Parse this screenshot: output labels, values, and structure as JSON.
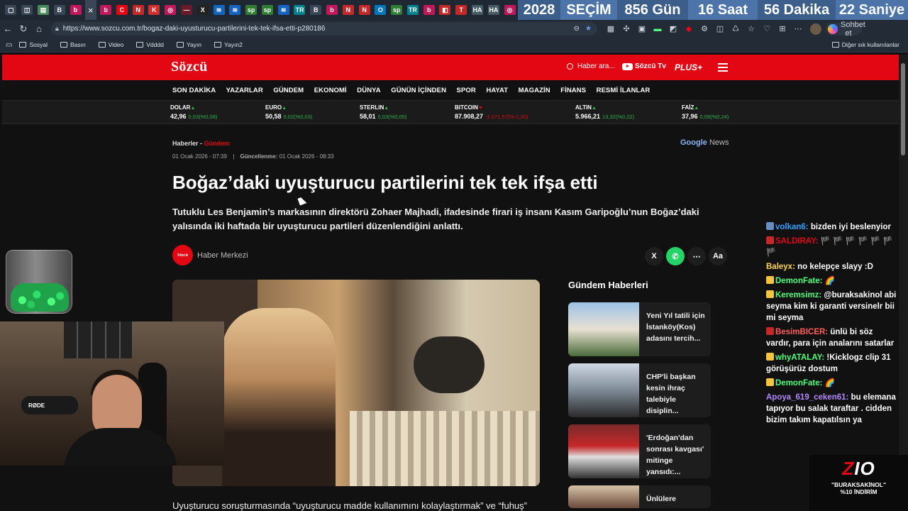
{
  "countdown": {
    "year": "2028",
    "label": "SEÇİM",
    "days": "856 Gün",
    "hours": "16 Saat",
    "minutes": "56 Dakika",
    "seconds": "22 Saniye"
  },
  "tabs": [
    {
      "glyph": "▢",
      "color": "#3a4656"
    },
    {
      "glyph": "◫",
      "color": "#3a4656"
    },
    {
      "glyph": "▤",
      "color": "#4a8a5a"
    },
    {
      "glyph": "B",
      "color": "#3a4656"
    },
    {
      "glyph": "b",
      "color": "#c2185b"
    },
    {
      "glyph": "b",
      "color": "#c2185b"
    },
    {
      "glyph": "C",
      "color": "#e30613"
    },
    {
      "glyph": "N",
      "color": "#c62828"
    },
    {
      "glyph": "K",
      "color": "#d32f2f"
    },
    {
      "glyph": "◎",
      "color": "#c2185b"
    },
    {
      "glyph": "—",
      "color": "#6a1b2a"
    },
    {
      "glyph": "X",
      "color": "#222222"
    },
    {
      "glyph": "≋",
      "color": "#1565c0"
    },
    {
      "glyph": "≋",
      "color": "#1565c0"
    },
    {
      "glyph": "sp",
      "color": "#2e7d32"
    },
    {
      "glyph": "sp",
      "color": "#2e7d32"
    },
    {
      "glyph": "≋",
      "color": "#1565c0"
    },
    {
      "glyph": "TR",
      "color": "#00838f"
    },
    {
      "glyph": "B",
      "color": "#3a4656"
    },
    {
      "glyph": "b",
      "color": "#c2185b"
    },
    {
      "glyph": "N",
      "color": "#c62828"
    },
    {
      "glyph": "N",
      "color": "#c62828"
    },
    {
      "glyph": "O",
      "color": "#0277bd"
    },
    {
      "glyph": "sp",
      "color": "#2e7d32"
    },
    {
      "glyph": "TR",
      "color": "#00838f"
    },
    {
      "glyph": "b",
      "color": "#c2185b"
    },
    {
      "glyph": "◧",
      "color": "#c62828"
    },
    {
      "glyph": "T",
      "color": "#c62828"
    },
    {
      "glyph": "HA",
      "color": "#455a64"
    },
    {
      "glyph": "HA",
      "color": "#455a64"
    },
    {
      "glyph": "◎",
      "color": "#c2185b"
    }
  ],
  "active_tab_close": "×",
  "address": {
    "url": "https://www.sozcu.com.tr/bogaz-daki-uyusturucu-partilerini-tek-tek-ifsa-etti-p280186"
  },
  "copilot_label": "Sohbet et",
  "bookmarks": [
    "Sosyal",
    "Basın",
    "Video",
    "Vdddd",
    "Yayın",
    "Yayın2"
  ],
  "other_bookmarks": "Diğer sık kullanılanlar",
  "site": {
    "logo": "Sözcü",
    "search_placeholder": "Haber ara...",
    "tv": "Sözcü Tv",
    "plus": "PLUS+",
    "nav": [
      "SON DAKİKA",
      "YAZARLAR",
      "GÜNDEM",
      "EKONOMİ",
      "DÜNYA",
      "GÜNÜN İÇİNDEN",
      "SPOR",
      "HAYAT",
      "MAGAZİN",
      "FİNANS",
      "RESMİ İLANLAR"
    ]
  },
  "ticker": [
    {
      "name": "DOLAR",
      "dir": "▲",
      "value": "42,96",
      "change": "0,03(%0,08)",
      "trend": "up"
    },
    {
      "name": "EURO",
      "dir": "▲",
      "value": "50,58",
      "change": "0,02(%0,03)",
      "trend": "up"
    },
    {
      "name": "STERLIN",
      "dir": "▲",
      "value": "58,01",
      "change": "0,03(%0,05)",
      "trend": "up"
    },
    {
      "name": "BITCOIN",
      "dir": "▼",
      "value": "87.908,27",
      "change": "-1.071,57(%-1,20)",
      "trend": "down"
    },
    {
      "name": "ALTIN",
      "dir": "▲",
      "value": "5.966,21",
      "change": "13,32(%0,22)",
      "trend": "up"
    },
    {
      "name": "FAİZ",
      "dir": "▲",
      "value": "37,96",
      "change": "0,09(%0,24)",
      "trend": "up"
    }
  ],
  "article": {
    "crumb_home": "Haberler -",
    "crumb_section": "Gündem",
    "published": "01 Ocak 2026 - 07:39",
    "updated_label": "Güncellenme:",
    "updated": "01 Ocak 2026 - 08:33",
    "google_news": "Google",
    "google_news_suffix": "News",
    "title": "Boğaz’daki uyuşturucu partilerini tek tek ifşa etti",
    "lead": "Tutuklu Les Benjamin’s markasının direktörü Zohaer Majhadi, ifadesinde firari iş insanı Kasım Garipoğlu’nun Boğaz’daki yalısında iki haftada bir uyuşturucu partileri düzenlendiğini anlattı.",
    "author": "Haber Merkezi",
    "author_logo": "Sözcü",
    "body_start": "Uyuşturucu soruşturmasında “uyuşturucu madde kullanımını kolaylaştırmak” ve “fuhuş”"
  },
  "share_icons": [
    "X",
    "✆",
    "⋯",
    "Aa"
  ],
  "sidebar": {
    "title": "Gündem Haberleri",
    "items": [
      {
        "text": "Yeni Yıl tatili için İstanköy(Kos) adasını tercih..."
      },
      {
        "text": "CHP'li başkan kesin ihraç talebiyle disiplin..."
      },
      {
        "text": "'Erdoğan'dan sonrası kavgası' mitinge yansıdı:..."
      },
      {
        "text": "Ünlülere"
      }
    ]
  },
  "webcam": {
    "mic_label": "RØDE"
  },
  "chat": [
    {
      "user": "volkan6:",
      "text": "bizden iyi beslenyior",
      "color": "#29a3ff",
      "badge": "#6a8fbf"
    },
    {
      "user": "SALDIRAY:",
      "text": "🏴 🏴 🏴 🏴 🏴 🏴 🏴",
      "color": "#e30613",
      "badge": "#c62828"
    },
    {
      "user": "Baleyx:",
      "text": "no kelepçe slayy :D",
      "color": "#ffd54f",
      "badge": ""
    },
    {
      "user": "DemonFate:",
      "text": "🌈",
      "color": "#4dff7a",
      "badge": "#f5c542"
    },
    {
      "user": "Keremsimz:",
      "text": "@buraksakinol abi seyma kim ki garanti versinelr bii mi seyma",
      "color": "#4dff7a",
      "badge": "#f5c542"
    },
    {
      "user": "BesimBICER:",
      "text": "ünlü bi söz vardır, para için analarını satarlar",
      "color": "#ff5c5c",
      "badge": "#c62828"
    },
    {
      "user": "whyATALAY:",
      "text": "!Kicklogz clip 31 görüşürüz dostum",
      "color": "#4dff7a",
      "badge": "#f5c542"
    },
    {
      "user": "DemonFate:",
      "text": "🌈",
      "color": "#4dff7a",
      "badge": "#f5c542"
    },
    {
      "user": "Apoya_619_ceken61:",
      "text": "bu elemana tapıyor bu salak taraftar . cidden bizim takım kapatılsın ya",
      "color": "#b388ff",
      "badge": ""
    }
  ],
  "promo": {
    "logo_a": "Z",
    "logo_b": "IO",
    "line1": "\"BURAKSAKİNOL\"",
    "line2": "%10 İNDİRİM"
  }
}
